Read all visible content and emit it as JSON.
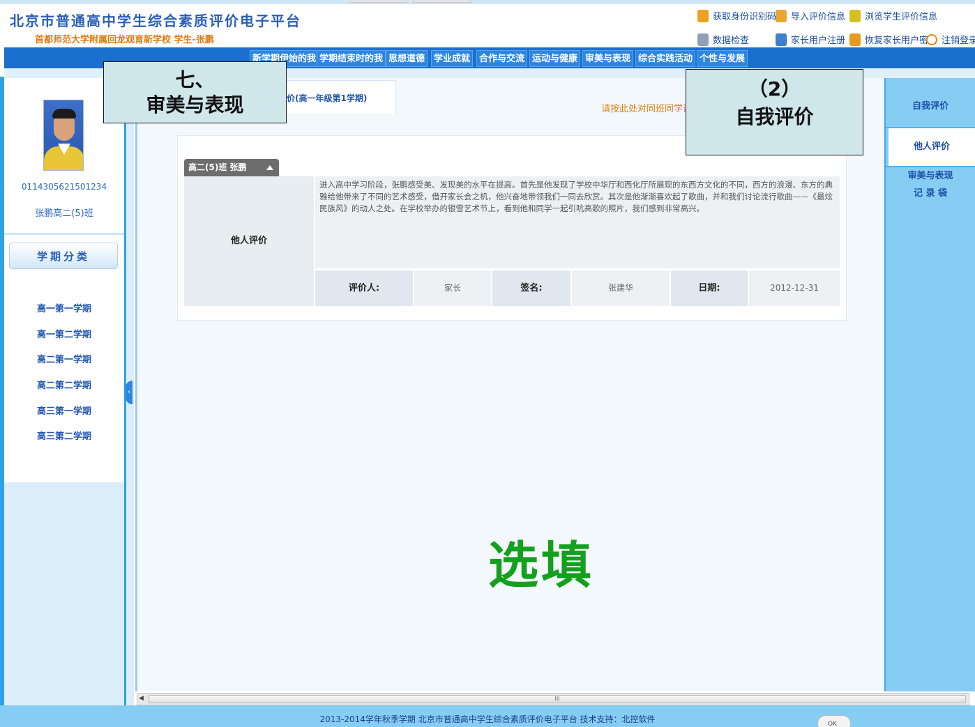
{
  "header": {
    "title": "北京市普通高中学生综合素质评价电子平台",
    "subtitle": "首都师范大学附属回龙观育新学校 学生-张鹏",
    "links": [
      {
        "label": "获取身份识别码",
        "icon": "hand-cursor-icon",
        "color": "#f0a020"
      },
      {
        "label": "导入评价信息",
        "icon": "import-icon",
        "color": "#e8a730"
      },
      {
        "label": "浏览学生评价信息",
        "icon": "book-icon",
        "color": "#d6c020"
      },
      {
        "label": "数据检查",
        "icon": "wrench-icon",
        "color": "#8da0b8"
      },
      {
        "label": "家长用户注册",
        "icon": "user-add-icon",
        "color": "#3d7fd0"
      },
      {
        "label": "恢复家长用户密码",
        "icon": "key-icon",
        "color": "#e89a20"
      },
      {
        "label": "注销登录",
        "icon": "logout-icon",
        "color": "#f08a10"
      }
    ]
  },
  "nav": {
    "items": [
      "新学期伊始的我",
      "学期结束时的我",
      "思想道德",
      "学业成就",
      "合作与交流",
      "运动与健康",
      "审美与表现",
      "综合实践活动",
      "个性与发展"
    ]
  },
  "student": {
    "id": "0114305621501234",
    "name_class": "张鹏高二(5)班"
  },
  "terms": {
    "header": "学期分类",
    "items": [
      "高一第一学期",
      "高一第二学期",
      "高二第一学期",
      "高二第二学期",
      "高三第一学期",
      "高三第二学期"
    ]
  },
  "main": {
    "crumb": "价(高一年级第1学期)",
    "hint": "请按此处对同班同学评价",
    "card_tab": "高二(5)班 张鹏",
    "eval_label": "他人评价",
    "eval_text": "进入高中学习阶段，张鹏感受美、发现美的水平在提高。首先是他发现了学校中华厅和西化厅所展现的东西方文化的不同，西方的浪漫、东方的典雅给他带来了不同的艺术感受，借开家长会之机，他兴奋地带领我们一同去欣赏。其次是他渐渐喜欢起了歌曲，并和我们讨论流行歌曲——《最炫民族风》的动人之处。在学校举办的银雪艺术节上，看到他和同学一起引吭高歌的照片，我们感到非常高兴。",
    "evaluator_label": "评价人:",
    "evaluator_value": "家长",
    "sign_label": "签名:",
    "sign_value": "张建华",
    "date_label": "日期:",
    "date_value": "2012-12-31",
    "big_note": "选填"
  },
  "right_menu": {
    "items": [
      "自我评价",
      "他人评价",
      "审美与表现",
      "记 录 袋"
    ]
  },
  "callouts": {
    "left_line1": "七、",
    "left_line2": "审美与表现",
    "right_line1": "（2）",
    "right_line2": "自我评价"
  },
  "scrollbar": {
    "grip": "III"
  },
  "footer": {
    "text": "2013-2014学年秋季学期 北京市普通高中学生综合素质评价电子平台 技术支持：北控软件",
    "badge": "OK"
  }
}
